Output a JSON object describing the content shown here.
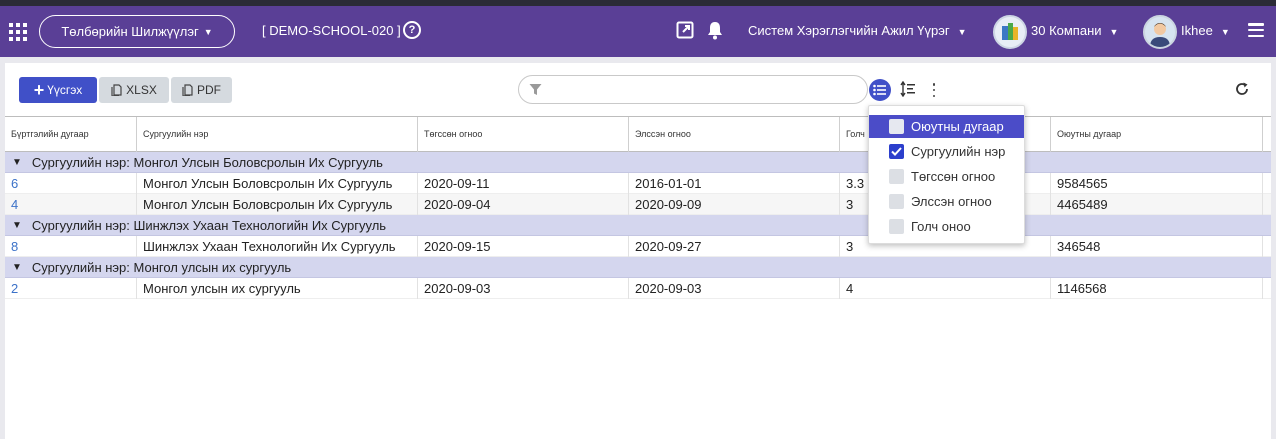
{
  "navbar": {
    "module_button": "Төлбөрийн Шилжүүлэг",
    "school_code": "[ DEMO-SCHOOL-020 ]",
    "help": "?",
    "role": "Систем Хэрэглэгчийн Ажил Үүрэг",
    "company": "30 Компани",
    "user": "Ikhee"
  },
  "toolbar": {
    "add_label": "Үүсгэх",
    "xlsx_label": "XLSX",
    "pdf_label": "PDF",
    "filter_placeholder": ""
  },
  "table": {
    "columns": [
      "Бүртгэлийн дугаар",
      "Сургуулийн нэр",
      "Төгссөн огноо",
      "Элссэн огноо",
      "Голч",
      "Оюутны дугаар"
    ],
    "groups": [
      {
        "label": "Сургуулийн нэр: Монгол Улсын Боловсролын Их Сургууль",
        "rows": [
          [
            "6",
            "Монгол Улсын Боловсролын Их Сургууль",
            "2020-09-11",
            "2016-01-01",
            "3.3",
            "9584565"
          ],
          [
            "4",
            "Монгол Улсын Боловсролын Их Сургууль",
            "2020-09-04",
            "2020-09-09",
            "3",
            "4465489"
          ]
        ]
      },
      {
        "label": "Сургуулийн нэр: Шинжлэх Ухаан Технологийн Их Сургууль",
        "rows": [
          [
            "8",
            "Шинжлэх Ухаан Технологийн Их Сургууль",
            "2020-09-15",
            "2020-09-27",
            "3",
            "346548"
          ]
        ]
      },
      {
        "label": "Сургуулийн нэр: Монгол улсын их сургууль",
        "rows": [
          [
            "2",
            "Монгол улсын их сургууль",
            "2020-09-03",
            "2020-09-03",
            "4",
            "1146568"
          ]
        ]
      }
    ]
  },
  "column_menu": {
    "items": [
      {
        "label": "Оюутны дугаар",
        "checked": false,
        "active": true
      },
      {
        "label": "Сургуулийн нэр",
        "checked": true,
        "active": false
      },
      {
        "label": "Төгссөн огноо",
        "checked": false,
        "active": false
      },
      {
        "label": "Элссэн огноо",
        "checked": false,
        "active": false
      },
      {
        "label": "Голч оноо",
        "checked": false,
        "active": false
      }
    ]
  },
  "colors": {
    "navbar": "#5a3f96",
    "primary": "#4050c8",
    "group_row": "#d4d6ee",
    "link": "#3c72c8"
  },
  "icons": [
    "apps-grid-icon",
    "help-icon",
    "external-link-icon",
    "bell-icon",
    "company-logo",
    "user-avatar",
    "hamburger-menu-icon",
    "plus-icon",
    "document-icon",
    "filter-icon",
    "column-list-icon",
    "sort-icon",
    "more-vert-icon",
    "refresh-icon"
  ]
}
